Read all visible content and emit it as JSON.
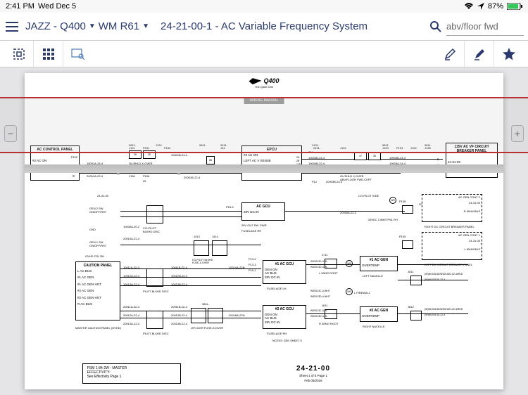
{
  "status": {
    "time": "2:41 PM",
    "date": "Wed Dec 5",
    "battery": "87%"
  },
  "nav": {
    "crumb1": "JAZZ - Q400",
    "crumb2": "WM R61",
    "doc_title": "24-21-00-1 - AC Variable Frequency System",
    "search_value": "abv/floor fwd"
  },
  "page": {
    "logo": "Q400",
    "logo_sub": "The Quiet One",
    "wm_tab": "WIRING MANUAL",
    "handle_minus": "−",
    "handle_plus": "+"
  },
  "boxes": {
    "ac_control": {
      "title": "AC CONTROL PANEL",
      "rows": [
        "#2 AC ON",
        "#1 AC ON"
      ],
      "refs": [
        "P102",
        "L",
        "S",
        "10001A-24-4",
        "20001A-22-4"
      ]
    },
    "epcu": {
      "title": "EPCU",
      "lines": [
        "#2 AC ON",
        "LEFT AC V SENSE",
        "#1 AC ON"
      ],
      "pins": [
        "2A",
        "2B",
        "11B",
        "4"
      ]
    },
    "breaker": {
      "title": "115V AC VF CIRCUIT BREAKER PANEL",
      "ref": "24-51-00"
    },
    "caution": {
      "title": "CAUTION PANEL",
      "rows": [
        "L AC BUS",
        "#1 AC GEN",
        "#1 AC GEN HOT",
        "#2 AC GEN",
        "#2 AC GEN HOT",
        "R AC BUS"
      ]
    },
    "ac_gcu1": {
      "title": "AC GCU",
      "line": "28V DC IN"
    },
    "ac_gcu2": {
      "title": "#1 AC GCU",
      "lines": [
        "GEN ON",
        "AC BUS",
        "28V DC IN"
      ]
    },
    "ac_gen1": {
      "title": "#1 AC GEN",
      "line": "OVERTEMP"
    },
    "ac_gcu3": {
      "title": "#2 AC GCU",
      "lines": [
        "GEN ON",
        "AC BUS",
        "28V DC IN"
      ]
    },
    "ac_gen2": {
      "title": "#2 AC GEN",
      "line": "OVERTEMP"
    },
    "right_dc": {
      "label": "RIGHT DC CIRCUIT BREAKER PANEL"
    },
    "left_dc": {
      "label": "LEFT DC CIRCUIT BREAKER PANEL"
    },
    "ac_cont2": {
      "label": "AC GEN CONT 2"
    },
    "ac_cont1": {
      "label": "AC GEN CONT 1"
    }
  },
  "labels": {
    "gen2sw": "GEN 2 SW\nON/OFF/RST",
    "gen1sw": "GEN 1 SW\nON/OFF/RST",
    "gnd": "GND",
    "ovhd": "OVHD CSL RH",
    "master": "MASTER CAUTION PANEL (OVHD)",
    "fuselage_lh": "FUSELAGE LH",
    "fuselage_rh": "FUSELAGE RH",
    "left_nacelle": "LEFT NACELLE",
    "right_nacelle": "RIGHT NACELLE",
    "l_firewall": "L FIREWALL",
    "l_wingroot": "L WING ROOT",
    "r_wingroot": "R WING ROOT",
    "notes": "NOTES: SEE SHEET 5",
    "pilot_blkhd": "PILOT BLKHD DISC",
    "copilot_blkhd": "CO-PILOT\nBLKHD DISC",
    "copilot_side": "CO-PILOT SIDE",
    "ufloor": "U/FLOOR FUSE-X-OVER",
    "glshld1": "GL/SHLD X-OVER\nABV/FLOOR FWD.CKPT",
    "glshld2": "GL/SHLD X-OVER\nABV/FLOOR FWD.CKPT",
    "sw_pwr": "28V OUT SW. PWR",
    "cbkr": "26VDC C/BKR PNL RH",
    "main_bus1": "R MAIN BUS",
    "main_bus2": "L MAIN BUS",
    "w_refs_top": [
      "9811-",
      "J191",
      "P191",
      "J192",
      "P192",
      "9811-",
      "2431-",
      "J44",
      "2431-",
      "J192",
      "P11",
      "9811-",
      "J193",
      "P193",
      "J192",
      "9811-",
      "J138"
    ],
    "wire_ids_top": [
      "10001A-24-4",
      "10001B-24-4",
      "36",
      "36",
      "68",
      "P31",
      "10003B-24-4",
      "10003B-24-4",
      "37",
      "38",
      "10003A-24-4",
      "10005A-24-4",
      "B",
      "C"
    ],
    "wire_ids_mid": [
      "10004B-22-4",
      "10004A-24-4",
      "20016A-22-2",
      "20018C-22-2"
    ],
    "wire_refs": [
      "J196",
      "P196",
      "25",
      "P31",
      "2431-",
      "P12",
      "20001B-22-4",
      "20003B-24-4"
    ],
    "p_refs": [
      "P13-1",
      "P13-2",
      "P13-3",
      "P15-1",
      "P15-2",
      "P15-3",
      "P108",
      "P105",
      "J710",
      "J711",
      "J611",
      "J413",
      "J414",
      "J811",
      "J812"
    ],
    "wire_list_caution": [
      "10011A-22-4",
      "10012A-22-4",
      "10013A-22-4",
      "20011A-22-4",
      "20012A-22-4",
      "20013A-22-4"
    ],
    "wire_list_mid": [
      "10006A-20-2",
      "20015A-22-4",
      "10011B-22-4",
      "10012B-22-4",
      "10013B-22-4",
      "20011B-22-4",
      "20012B-22-4",
      "20013B-22-4",
      "10014A-22N",
      "20018A-22N"
    ],
    "wire_list_right": [
      "W10013C-4-RL",
      "W10013D-4-RL",
      "W20013C-4-RL",
      "W20013D-4-RL",
      "W20013C-4-WHT",
      "W20013D-4-WHT"
    ],
    "wire_cont": [
      "(W)W10013D/W20013D-22-4/RED",
      "(W)W10013D-22-4",
      "(W)W10013D/W20013D-22-4/RED",
      "(W)W20013D-22-4"
    ]
  },
  "title_block": {
    "eff_line1": "PSM 1-84-2W  -  MASTER",
    "eff_line2": "EFFECTIVITY:",
    "eff_line3": "See Effectivity Page 1",
    "docnum": "24-21-00",
    "sheet": "Sheet 1 of 5 Page 1",
    "date": "Feb 05/2016"
  },
  "chart_data": {
    "type": "table",
    "title": "AC Variable Frequency System Wiring Diagram 24-21-00-1",
    "components": [
      {
        "id": "AC CONTROL PANEL",
        "signals": [
          "#2 AC ON",
          "#1 AC ON"
        ],
        "connector": "P102"
      },
      {
        "id": "EPCU",
        "signals": [
          "#2 AC ON",
          "LEFT AC V SENSE",
          "#1 AC ON"
        ],
        "pins": [
          "2A",
          "2B",
          "11B",
          "4"
        ]
      },
      {
        "id": "115V AC VF CIRCUIT BREAKER PANEL",
        "ref": "24-51-00"
      },
      {
        "id": "CAUTION PANEL",
        "signals": [
          "L AC BUS",
          "#1 AC GEN",
          "#1 AC GEN HOT",
          "#2 AC GEN",
          "#2 AC GEN HOT",
          "R AC BUS"
        ]
      },
      {
        "id": "AC GCU",
        "signals": [
          "28V DC IN",
          "28V OUT SW. PWR"
        ]
      },
      {
        "id": "#1 AC GCU",
        "signals": [
          "GEN ON",
          "AC BUS",
          "28V DC IN"
        ],
        "zone": "FUSELAGE LH"
      },
      {
        "id": "#1 AC GEN",
        "signals": [
          "OVERTEMP"
        ],
        "zone": "LEFT NACELLE"
      },
      {
        "id": "#2 AC GCU",
        "signals": [
          "GEN ON",
          "AC BUS",
          "28V DC IN"
        ],
        "zone": "FUSELAGE RH"
      },
      {
        "id": "#2 AC GEN",
        "signals": [
          "OVERTEMP"
        ],
        "zone": "RIGHT NACELLE"
      },
      {
        "id": "AC GEN CONT 1",
        "zone": "LEFT DC CIRCUIT BREAKER PANEL"
      },
      {
        "id": "AC GEN CONT 2",
        "zone": "RIGHT DC CIRCUIT BREAKER PANEL"
      }
    ],
    "wires": [
      "10001A-24-4",
      "10001B-24-4",
      "20001A-22-4",
      "20001B-22-4",
      "10003B-24-4",
      "10003A-24-4",
      "10004B-22-4",
      "10004A-24-4",
      "10005A-24-4",
      "10006A-20-2",
      "10011A-22-4",
      "10012A-22-4",
      "10013A-22-4",
      "20011A-22-4",
      "20012A-22-4",
      "20013A-22-4",
      "20015A-22-4",
      "20016A-22-2",
      "20018C-22-2",
      "W10013C-4-RL",
      "W20013C-4-RL"
    ]
  }
}
